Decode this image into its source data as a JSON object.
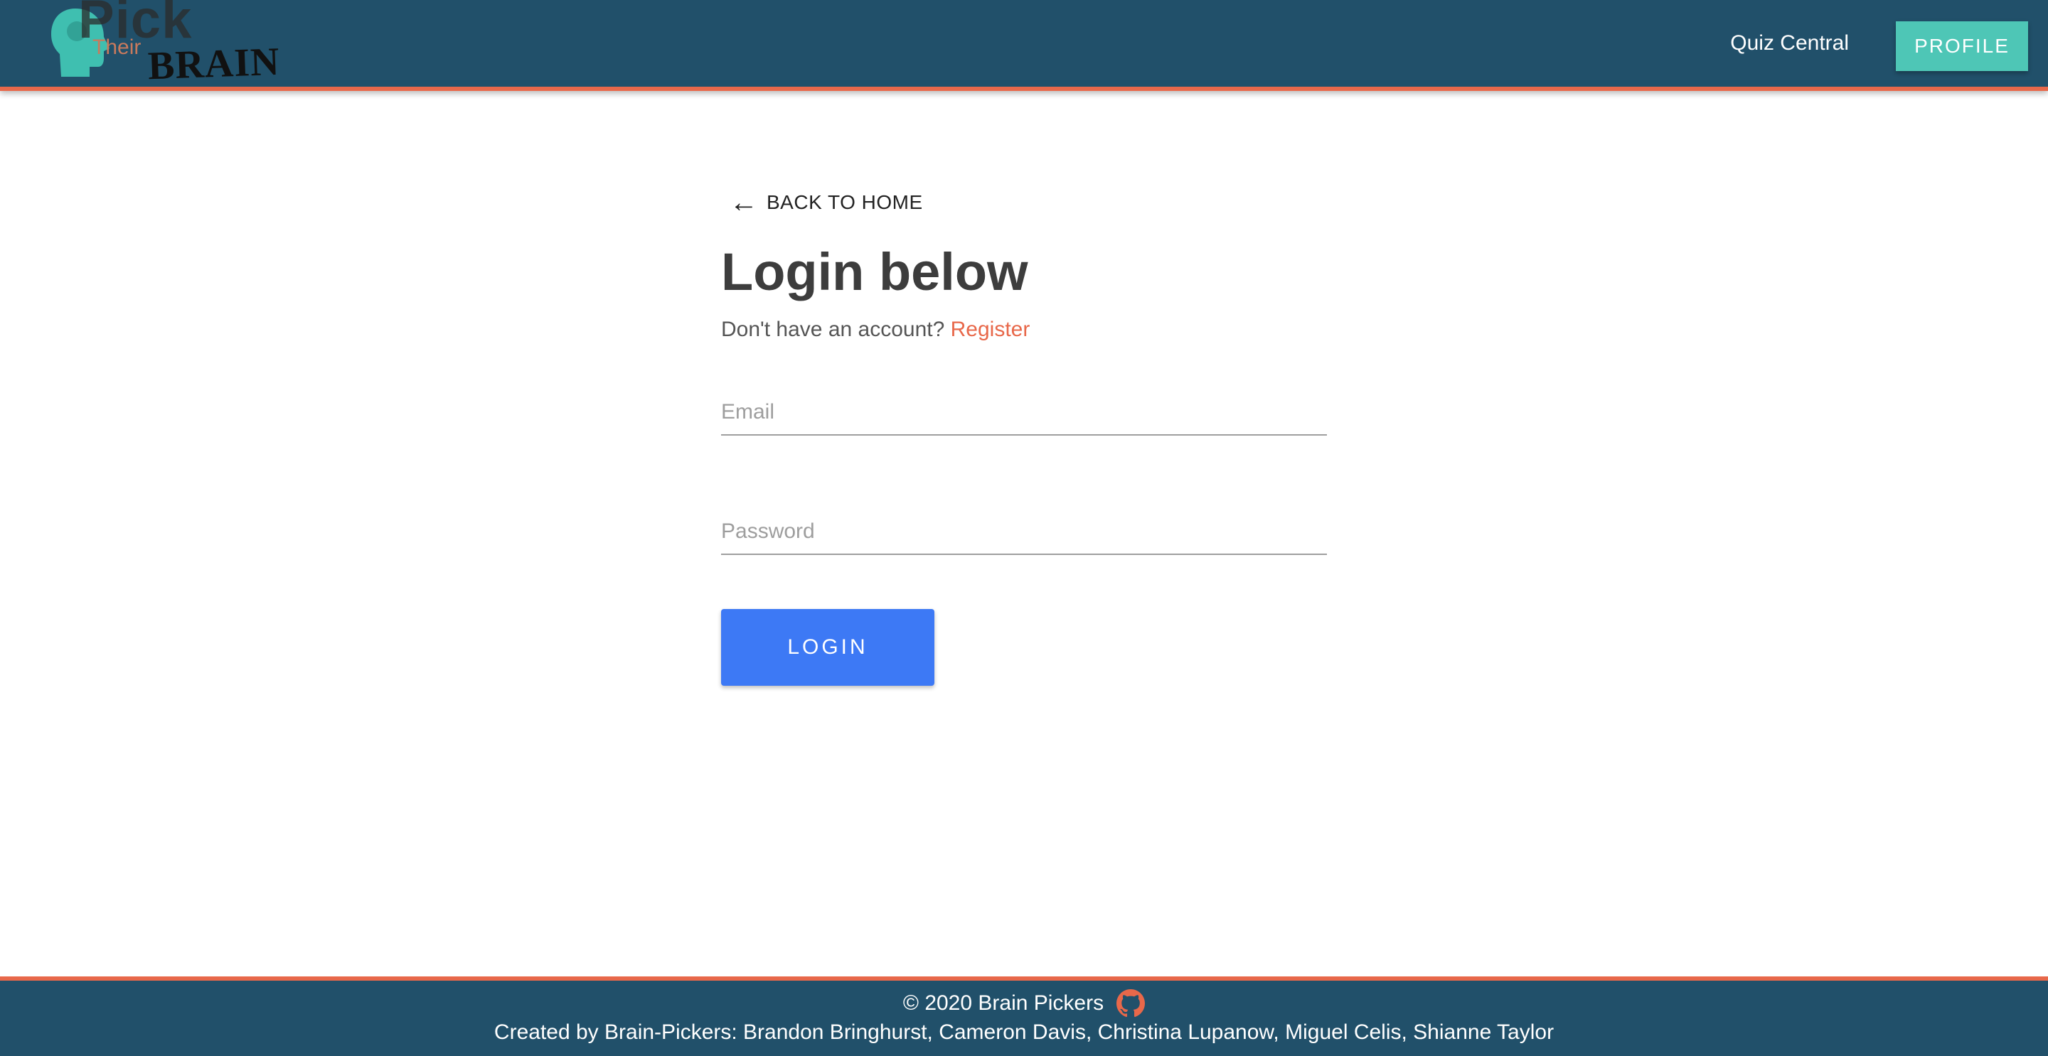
{
  "brand": {
    "logo_word_1": "Pick",
    "logo_word_2": "Their",
    "logo_word_3": "BRAIN",
    "colors": {
      "navbar": "#21506a",
      "accent": "#e8684a",
      "profile_button": "#4ec6b6",
      "login_button": "#3d79f5"
    }
  },
  "nav": {
    "quiz_link": "Quiz Central",
    "profile_button": "PROFILE"
  },
  "login": {
    "back_label": "BACK TO HOME",
    "back_icon": "arrow-left-icon",
    "title_bold": "Login",
    "title_rest": "below",
    "subtitle": "Don't have an account?",
    "register_link": "Register",
    "email_placeholder": "Email",
    "password_placeholder": "Password",
    "login_button": "LOGIN"
  },
  "footer": {
    "copyright": "© 2020 Brain Pickers",
    "github_icon": "github-icon",
    "credits": "Created by Brain-Pickers: Brandon Bringhurst, Cameron Davis, Christina Lupanow, Miguel Celis, Shianne Taylor"
  }
}
